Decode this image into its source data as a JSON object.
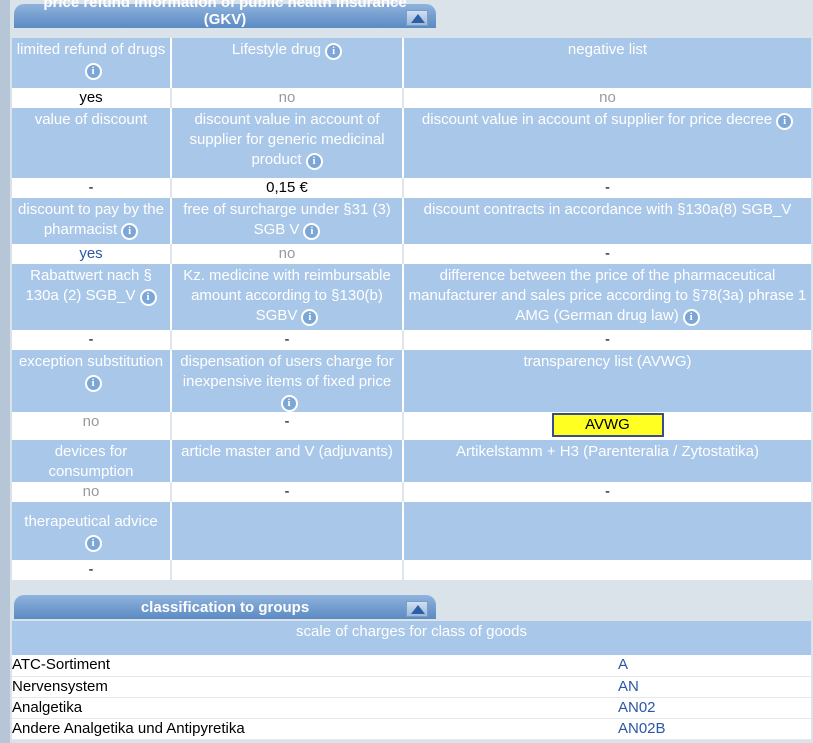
{
  "panel1": {
    "title": "price refund information of public health insurance (GKV)",
    "rows": [
      {
        "labels": [
          "limited refund of drugs",
          "Lifestyle drug",
          "negative list"
        ],
        "values": [
          "yes",
          "no",
          "no"
        ]
      },
      {
        "labels": [
          "value of discount",
          "discount value in account of supplier for generic medicinal product",
          "discount value in account of supplier for price decree"
        ],
        "values": [
          "-",
          "0,15 €",
          "-"
        ]
      },
      {
        "labels": [
          "discount to pay by the pharmacist",
          "free of surcharge under §31 (3) SGB V",
          "discount contracts in accordance with §130a(8) SGB_V"
        ],
        "values": [
          "yes",
          "no",
          "-"
        ]
      },
      {
        "labels": [
          "Rabattwert nach § 130a (2) SGB_V",
          "Kz. medicine with reimbursable amount according to §130(b) SGBV",
          "difference between the price of the pharmaceutical manufacturer and sales price according to §78(3a) phrase 1 AMG (German drug law)"
        ],
        "values": [
          "-",
          "-",
          "-"
        ]
      },
      {
        "labels": [
          "exception substitution",
          "dispensation of users charge for inexpensive items of fixed price",
          "transparency list (AVWG)"
        ],
        "values": [
          "no",
          "-",
          "AVWG"
        ]
      },
      {
        "labels": [
          "devices for consumption",
          "article master and V (adjuvants)",
          "Artikelstamm + H3 (Parenteralia / Zytostatika)"
        ],
        "values": [
          "no",
          "-",
          "-"
        ]
      },
      {
        "labels": [
          "therapeutical advice",
          "",
          ""
        ],
        "values": [
          "-",
          "",
          ""
        ]
      }
    ]
  },
  "panel2": {
    "title": "classification to groups",
    "scale_header": "scale of charges for class of goods",
    "classes": [
      {
        "name": "ATC-Sortiment",
        "code": "A"
      },
      {
        "name": "Nervensystem",
        "code": "AN"
      },
      {
        "name": "Analgetika",
        "code": "AN02"
      },
      {
        "name": "Andere Analgetika und Antipyretika",
        "code": "AN02B"
      }
    ]
  },
  "icons": {
    "info": "info-icon",
    "collapse": "collapse-up-arrow-icon"
  },
  "colors": {
    "header": "#6b97cc",
    "label_bg": "#a9c7e8",
    "avwg_button": "#ffff22",
    "link_blue": "#2a57a8"
  }
}
